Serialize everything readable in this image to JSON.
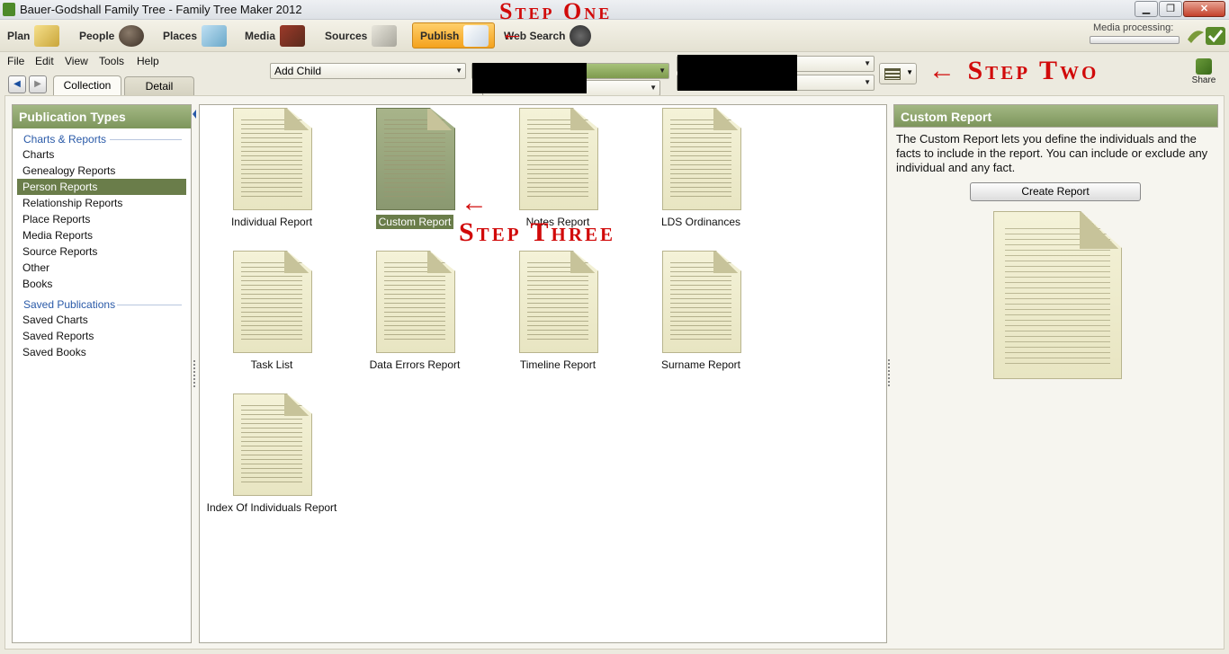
{
  "window": {
    "title": "Bauer-Godshall Family Tree - Family Tree Maker 2012",
    "min_glyph": "▁",
    "max_glyph": "❐",
    "close_glyph": "✕"
  },
  "toolbar": {
    "workspaces": [
      {
        "label": "Plan",
        "icon": "plan-icon"
      },
      {
        "label": "People",
        "icon": "people-icon"
      },
      {
        "label": "Places",
        "icon": "places-icon"
      },
      {
        "label": "Media",
        "icon": "media-icon"
      },
      {
        "label": "Sources",
        "icon": "sources-icon"
      },
      {
        "label": "Publish",
        "icon": "publish-icon",
        "active": true
      },
      {
        "label": "Web Search",
        "icon": "binoculars-icon"
      }
    ],
    "media_processing_label": "Media processing:",
    "media_processing_progress": 0
  },
  "menu": {
    "items": [
      "File",
      "Edit",
      "View",
      "Tools",
      "Help"
    ]
  },
  "person_bar": {
    "add_child_label": "Add Child",
    "share_label": "Share",
    "chevron": "▼"
  },
  "nav": {
    "back_glyph": "◀",
    "forward_glyph": "▶"
  },
  "tabs": [
    {
      "label": "Collection",
      "active": true
    },
    {
      "label": "Detail",
      "active": false
    }
  ],
  "left_panel": {
    "header": "Publication Types",
    "sections": [
      {
        "title": "Charts & Reports",
        "items": [
          "Charts",
          "Genealogy Reports",
          "Person Reports",
          "Relationship Reports",
          "Place Reports",
          "Media Reports",
          "Source Reports",
          "Other",
          "Books"
        ]
      },
      {
        "title": "Saved Publications",
        "items": [
          "Saved Charts",
          "Saved Reports",
          "Saved Books"
        ]
      }
    ],
    "selected_item": "Person Reports"
  },
  "reports": [
    {
      "label": "Individual Report"
    },
    {
      "label": "Custom Report",
      "selected": true
    },
    {
      "label": "Notes Report"
    },
    {
      "label": "LDS Ordinances"
    },
    {
      "label": "Task List"
    },
    {
      "label": "Data Errors Report"
    },
    {
      "label": "Timeline Report"
    },
    {
      "label": "Surname Report"
    },
    {
      "label": "Index Of Individuals Report"
    }
  ],
  "right_panel": {
    "header": "Custom Report",
    "description": "The Custom Report lets you define the individuals and the facts to include in the report. You can include or exclude any individual and any fact.",
    "create_button": "Create Report"
  },
  "annotations": {
    "step_one": "Step One",
    "step_two": "← Step Two",
    "step_three": "Step Three",
    "arrow": "←",
    "color": "#d10a0a"
  },
  "colors": {
    "accent_green": "#7d955b",
    "selected_green": "#6a7d4a",
    "publish_orange": "#f4a21d"
  }
}
